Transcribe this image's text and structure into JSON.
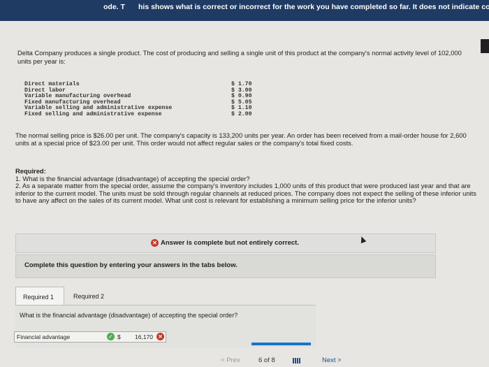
{
  "banner": {
    "left_fragment": "ode. T",
    "text": "his shows what is correct or incorrect for the work you have completed so far. It does not indicate completion"
  },
  "problem": {
    "intro": "Delta Company produces a single product. The cost of producing and selling a single unit of this product at the company's normal activity level of 102,000 units per year is:",
    "costs": [
      {
        "label": "Direct materials",
        "value": "$ 1.70"
      },
      {
        "label": "Direct labor",
        "value": "$ 3.00"
      },
      {
        "label": "Variable manufacturing overhead",
        "value": "$ 0.90"
      },
      {
        "label": "Fixed manufacturing overhead",
        "value": "$ 5.05"
      },
      {
        "label": "Variable selling and administrative expense",
        "value": "$ 1.10"
      },
      {
        "label": "Fixed selling and administrative expense",
        "value": "$ 2.00"
      }
    ],
    "paragraph2": "The normal selling price is $26.00 per unit. The company's capacity is 133,200 units per year. An order has been received from a mail-order house for 2,600 units at a special price of $23.00 per unit. This order would not affect regular sales or the company's total fixed costs."
  },
  "required": {
    "title": "Required:",
    "q1": "1. What is the financial advantage (disadvantage) of accepting the special order?",
    "q2": "2. As a separate matter from the special order, assume the company's inventory includes 1,000 units of this product that were produced last year and that are inferior to the current model. The units must be sold through regular channels at reduced prices. The company does not expect the selling of these inferior units to have any affect on the sales of its current model. What unit cost is relevant for establishing a minimum selling price for the inferior units?"
  },
  "status": {
    "message": "Answer is complete but not entirely correct.",
    "instruction": "Complete this question by entering your answers in the tabs below."
  },
  "tabs": [
    {
      "label": "Required 1"
    },
    {
      "label": "Required 2"
    }
  ],
  "answer": {
    "question": "What is the financial advantage (disadvantage) of accepting the special order?",
    "row_label": "Financial advantage",
    "currency": "$",
    "value": "16,170"
  },
  "navigation": {
    "prev": "< Prev",
    "page": "6 of 8",
    "next": "Next >"
  },
  "colors": {
    "banner": "#1f3a63",
    "error": "#c23a2b",
    "correct": "#4caf50",
    "link": "#1a4f8a"
  }
}
